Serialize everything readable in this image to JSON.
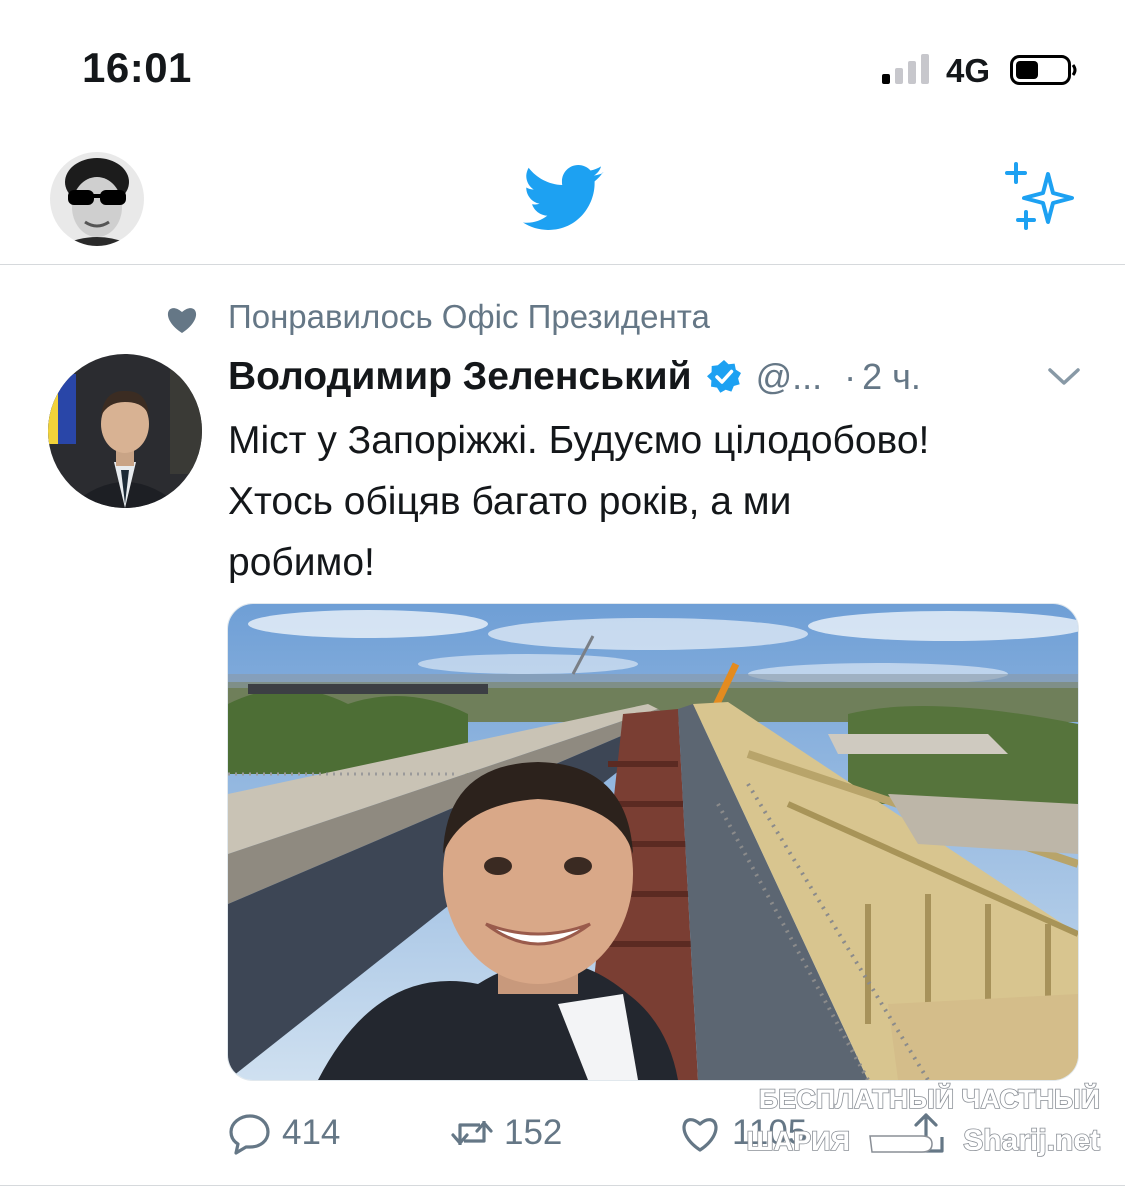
{
  "status_bar": {
    "time": "16:01",
    "network": "4G"
  },
  "nav": {
    "brand_icon": "twitter-bird-icon",
    "left_icon": "profile-avatar",
    "right_icon": "sparkle-icon"
  },
  "tweet": {
    "liked_by": "Понравилось Офіс Президента",
    "author_name": "Володимир Зеленський",
    "handle": "@...",
    "separator": "·",
    "time_ago": "2 ч.",
    "text_lines": [
      "Міст у Запоріжжі. Будуємо цілодобово!",
      "Хтось обіцяв багато років, а ми",
      "робимо!"
    ],
    "counts": {
      "replies": "414",
      "retweets": "152",
      "likes": "1105"
    }
  },
  "watermark": {
    "line1": "БЕСПЛАТНЫЙ ЧАСТНЫЙ",
    "line2": "ШАРИЯ",
    "site": "Sharij.net"
  },
  "colors": {
    "accent": "#1da1f2",
    "muted": "#657786",
    "text": "#14171a",
    "divider": "#d6d9dc"
  }
}
